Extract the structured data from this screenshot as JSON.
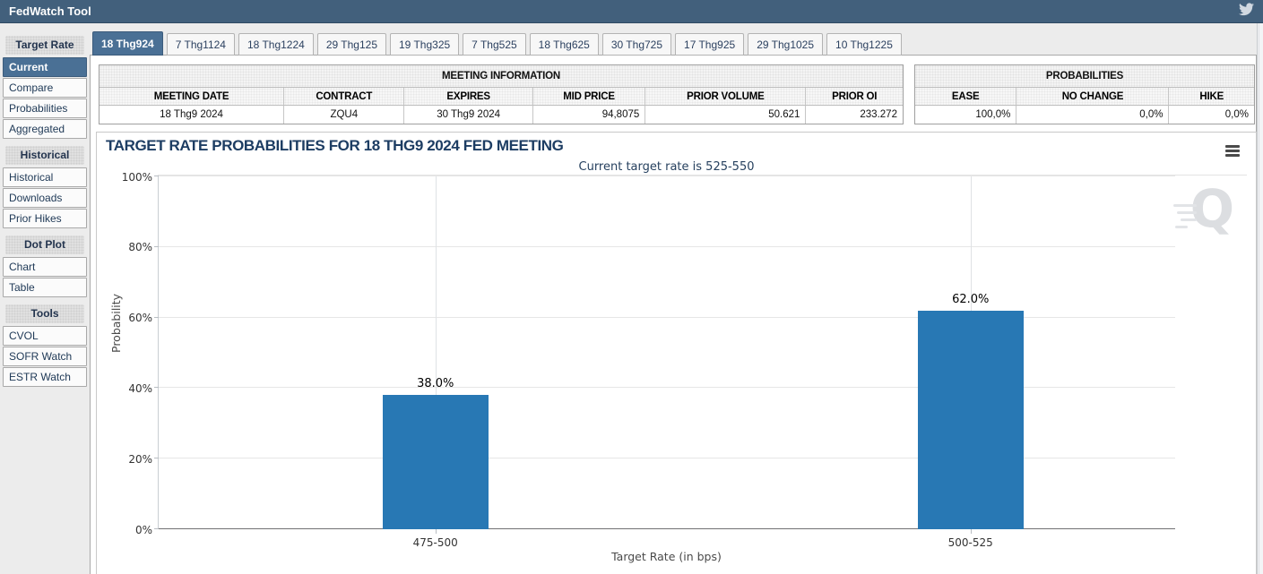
{
  "app": {
    "title": "FedWatch Tool",
    "twitter_icon": "twitter-bird"
  },
  "colors": {
    "top_bar": "#42607c",
    "selected": "#4a7095",
    "bar": "#2878b4"
  },
  "sidebar": {
    "sections": [
      {
        "header": "Target Rate",
        "items": [
          {
            "label": "Current",
            "selected": true
          },
          {
            "label": "Compare",
            "selected": false
          },
          {
            "label": "Probabilities",
            "selected": false
          },
          {
            "label": "Aggregated",
            "selected": false
          }
        ]
      },
      {
        "header": "Historical",
        "items": [
          {
            "label": "Historical",
            "selected": false
          },
          {
            "label": "Downloads",
            "selected": false
          },
          {
            "label": "Prior Hikes",
            "selected": false
          }
        ]
      },
      {
        "header": "Dot Plot",
        "items": [
          {
            "label": "Chart",
            "selected": false
          },
          {
            "label": "Table",
            "selected": false
          }
        ]
      },
      {
        "header": "Tools",
        "items": [
          {
            "label": "CVOL",
            "selected": false
          },
          {
            "label": "SOFR Watch",
            "selected": false
          },
          {
            "label": "ESTR Watch",
            "selected": false
          }
        ]
      }
    ]
  },
  "tabs": [
    {
      "label": "18 Thg924",
      "selected": true
    },
    {
      "label": "7 Thg1124",
      "selected": false
    },
    {
      "label": "18 Thg1224",
      "selected": false
    },
    {
      "label": "29 Thg125",
      "selected": false
    },
    {
      "label": "19 Thg325",
      "selected": false
    },
    {
      "label": "7 Thg525",
      "selected": false
    },
    {
      "label": "18 Thg625",
      "selected": false
    },
    {
      "label": "30 Thg725",
      "selected": false
    },
    {
      "label": "17 Thg925",
      "selected": false
    },
    {
      "label": "29 Thg1025",
      "selected": false
    },
    {
      "label": "10 Thg1225",
      "selected": false
    }
  ],
  "meeting_info": {
    "title": "MEETING INFORMATION",
    "columns": [
      "MEETING DATE",
      "CONTRACT",
      "EXPIRES",
      "MID PRICE",
      "PRIOR VOLUME",
      "PRIOR OI"
    ],
    "values": [
      "18 Thg9 2024",
      "ZQU4",
      "30 Thg9 2024",
      "94,8075",
      "50.621",
      "233.272"
    ]
  },
  "probabilities": {
    "title": "PROBABILITIES",
    "columns": [
      "EASE",
      "NO CHANGE",
      "HIKE"
    ],
    "values": [
      "100,0%",
      "0,0%",
      "0,0%"
    ]
  },
  "chart_data": {
    "type": "bar",
    "title": "TARGET RATE PROBABILITIES FOR 18 THG9 2024 FED MEETING",
    "subtitle": "Current target rate is 525-550",
    "categories": [
      "475-500",
      "500-525"
    ],
    "values": [
      38.0,
      62.0
    ],
    "data_labels": [
      "38.0%",
      "62.0%"
    ],
    "xlabel": "Target Rate (in bps)",
    "ylabel": "Probability",
    "ylim": [
      0,
      100
    ],
    "yticks": [
      0,
      20,
      40,
      60,
      80,
      100
    ],
    "ytick_labels": [
      "0%",
      "20%",
      "40%",
      "60%",
      "80%",
      "100%"
    ],
    "grid": true,
    "legend": "none",
    "bar_color": "#2878b4",
    "watermark": "Q",
    "menu_icon": "hamburger-menu"
  }
}
